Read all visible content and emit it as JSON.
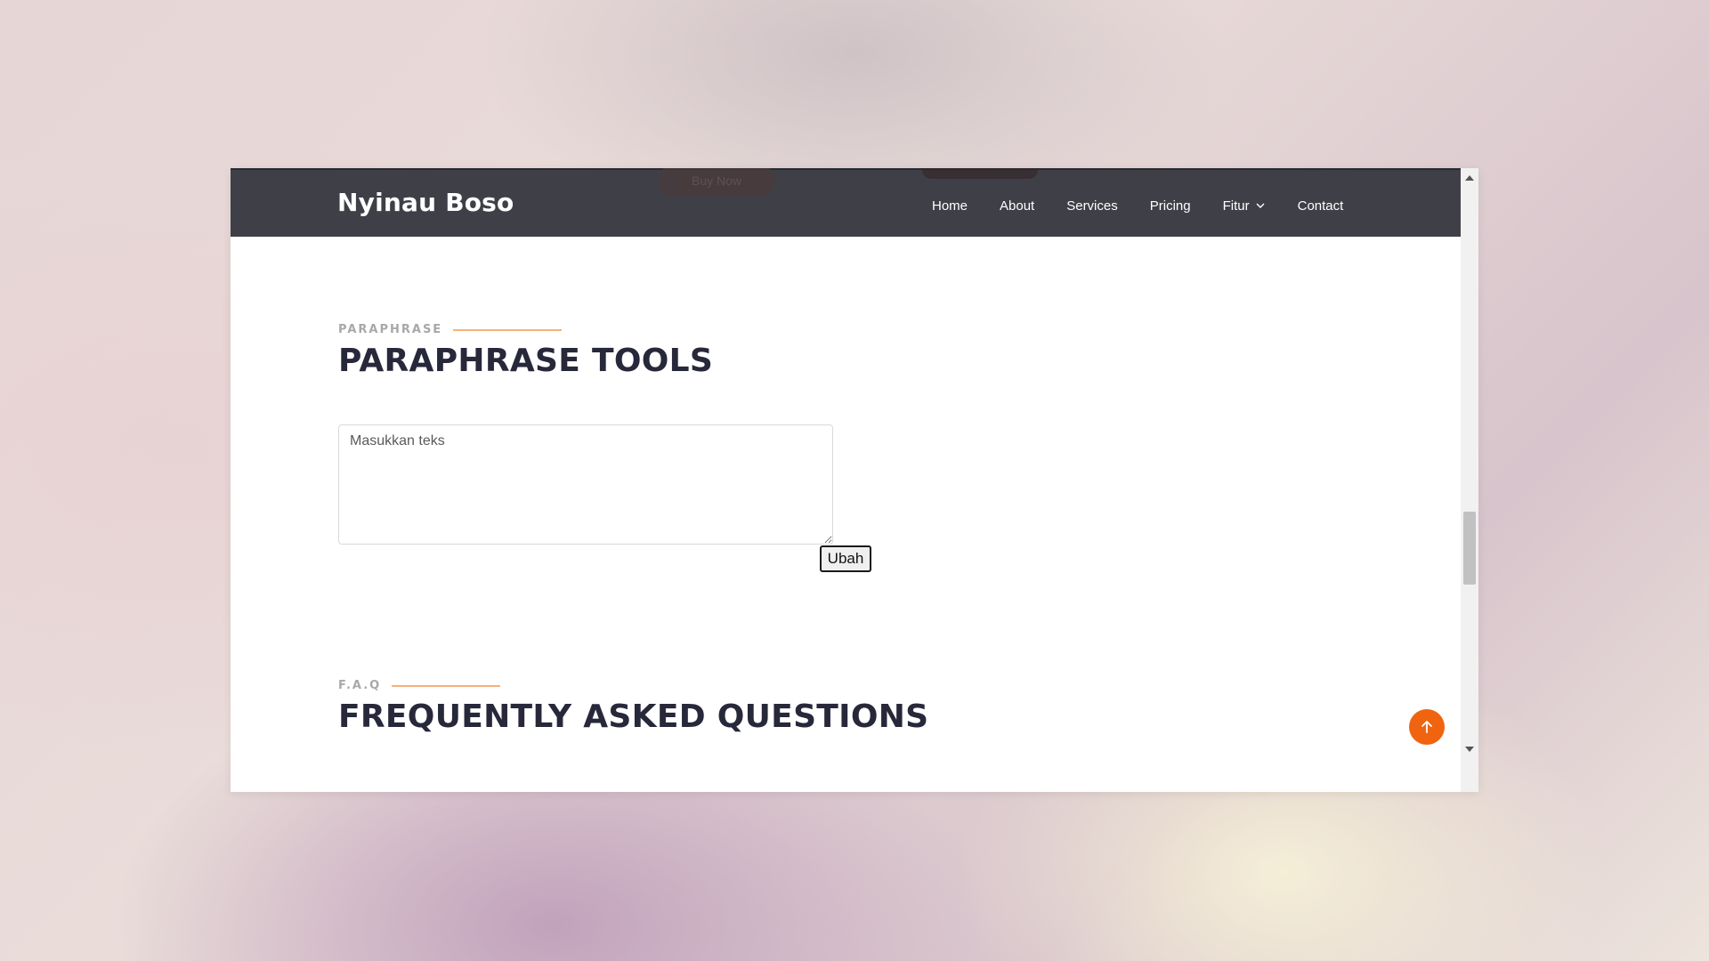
{
  "brand": "Nyinau Boso",
  "ghost": {
    "buy_now": "Buy Now"
  },
  "nav": [
    {
      "label": "Home"
    },
    {
      "label": "About"
    },
    {
      "label": "Services"
    },
    {
      "label": "Pricing"
    },
    {
      "label": "Fitur"
    },
    {
      "label": "Contact"
    }
  ],
  "paraphrase": {
    "subtitle": "PARAPHRASE",
    "title": "PARAPHRASE TOOLS",
    "textarea_placeholder": "Masukkan teks",
    "submit_label": "Ubah"
  },
  "faq": {
    "subtitle": "F.A.Q",
    "title": "FREQUENTLY ASKED QUESTIONS"
  },
  "colors": {
    "navbar": "#3f4047",
    "accent": "#f0640f",
    "subtitle_line": "#f2b37a",
    "title_text": "#27283a"
  },
  "icons": {
    "dropdown": "chevron-down-icon",
    "back_to_top": "arrow-up-icon"
  }
}
